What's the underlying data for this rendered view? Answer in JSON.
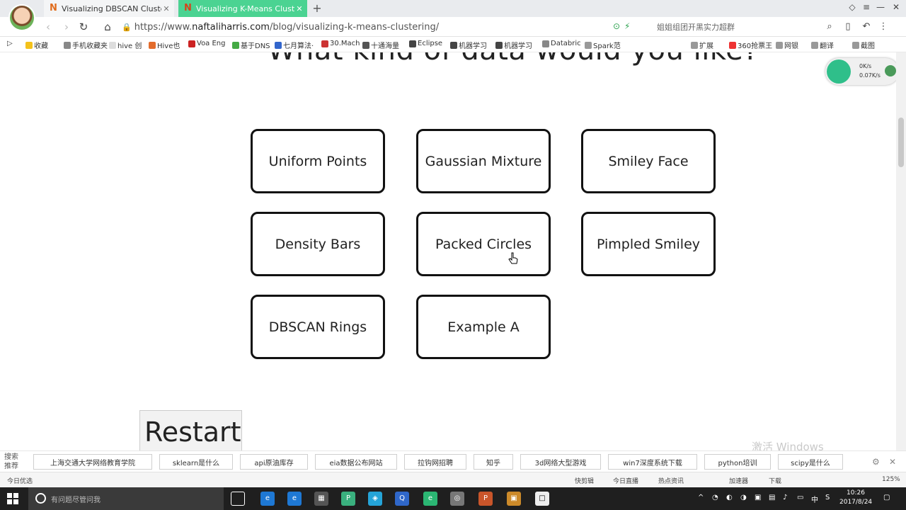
{
  "browser": {
    "tabs": [
      {
        "title": "Visualizing DBSCAN Clustering",
        "favicon": "N"
      },
      {
        "title": "Visualizing K-Means Clusteri",
        "favicon": "N"
      }
    ],
    "url": {
      "scheme": "https://www.",
      "domain": "naftaliharris.com",
      "path": "/blog/visualizing-k-means-clustering/"
    },
    "hot_search": "姐姐组团开黑实力超群",
    "bookmarks": [
      "收藏",
      "手机收藏夹",
      "hive 创",
      "Hive也",
      "Voa Eng",
      "基于DNS",
      "七月算法·",
      "30.Mach",
      "十通海量",
      "Eclipse",
      "机器学习",
      "机器学习",
      "Databric",
      "Spark范",
      "扩展",
      "360抢票王",
      "网银",
      "翻译",
      "截图"
    ],
    "speed": {
      "up": "0K/s",
      "down": "0.07K/s"
    }
  },
  "page": {
    "heading": "What kind of data would you like?",
    "choices": [
      "Uniform Points",
      "Gaussian Mixture",
      "Smiley Face",
      "Density Bars",
      "Packed Circles",
      "Pimpled Smiley",
      "DBSCAN Rings",
      "Example A"
    ],
    "restart_label": "Restart",
    "watermark": "激活 Windows"
  },
  "search_bar": {
    "label": "搜索推荐",
    "chips": [
      "上海交通大学网络教育学院",
      "sklearn是什么",
      "api原油库存",
      "eia数据公布网站",
      "拉钩网招聘",
      "知乎",
      "3d网络大型游戏",
      "win7深度系统下载",
      "python培训",
      "scipy是什么"
    ]
  },
  "status_bar": {
    "left": "今日优选",
    "items": [
      "快剪辑",
      "今日直播",
      "热点资讯",
      "加速器",
      "下载",
      "125%"
    ]
  },
  "taskbar": {
    "search_placeholder": "有问题尽管问我",
    "ime": "中",
    "time": "10:26",
    "date": "2017/8/24"
  }
}
